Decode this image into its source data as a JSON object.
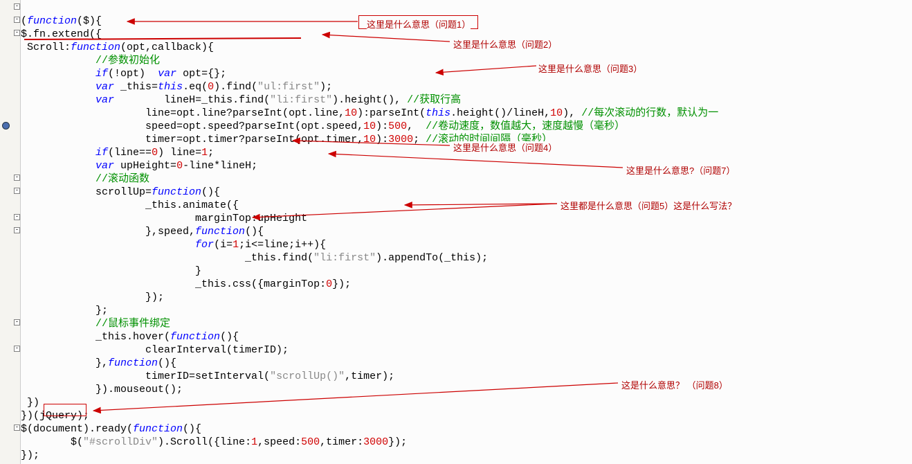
{
  "code": {
    "l1a": "(",
    "l1b": "function",
    "l1c": "($){",
    "l2a": "$.fn.extend({",
    "l3a": " Scroll:",
    "l3b": "function",
    "l3c": "(opt,callback){",
    "l4a": "            ",
    "l4cmt": "//参数初始化",
    "l5a": "            ",
    "l5b": "if",
    "l5c": "(!opt)  ",
    "l5d": "var",
    "l5e": " opt={};",
    "l6a": "            ",
    "l6b": "var",
    "l6c": " _this=",
    "l6d": "this",
    "l6e": ".eq(",
    "l6f": "0",
    "l6g": ").find(",
    "l6h": "\"ul:first\"",
    "l6i": ");",
    "l7a": "            ",
    "l7b": "var",
    "l7c": "        lineH=_this.find(",
    "l7d": "\"li:first\"",
    "l7e": ").height(), ",
    "l7cmt": "//获取行高",
    "l8a": "                    line=opt.line?parseInt(opt.line,",
    "l8b": "10",
    "l8c": "):parseInt(",
    "l8d": "this",
    "l8e": ".height()/lineH,",
    "l8f": "10",
    "l8g": "), ",
    "l8cmt": "//每次滚动的行数，默认为一",
    "l9a": "                    speed=opt.speed?parseInt(opt.speed,",
    "l9b": "10",
    "l9c": "):",
    "l9d": "500",
    "l9e": ",  ",
    "l9cmt": "//卷动速度，数值越大，速度越慢（毫秒）",
    "l10a": "                    timer=opt.timer?parseInt(opt.timer,",
    "l10b": "10",
    "l10c": "):",
    "l10d": "3000",
    "l10e": "; ",
    "l10cmt": "//滚动的时间间隔（毫秒）",
    "l11a": "            ",
    "l11b": "if",
    "l11c": "(line==",
    "l11d": "0",
    "l11e": ") line=",
    "l11f": "1",
    "l11g": ";",
    "l12a": "            ",
    "l12b": "var",
    "l12c": " upHeight=",
    "l12d": "0",
    "l12e": "-line*lineH;",
    "l13a": "            ",
    "l13cmt": "//滚动函数",
    "l14a": "            scrollUp=",
    "l14b": "function",
    "l14c": "(){",
    "l15a": "                    _this.animate({",
    "l16a": "                            marginTop:upHeight",
    "l17a": "                    },speed,",
    "l17b": "function",
    "l17c": "(){",
    "l18a": "                            ",
    "l18b": "for",
    "l18c": "(i=",
    "l18d": "1",
    "l18e": ";i<=line;i++){",
    "l19a": "                                    _this.find(",
    "l19b": "\"li:first\"",
    "l19c": ").appendTo(_this);",
    "l20a": "                            }",
    "l21a": "                            _this.css({marginTop:",
    "l21b": "0",
    "l21c": "});",
    "l22a": "                    });",
    "l23a": "            };",
    "l24a": "            ",
    "l24cmt": "//鼠标事件绑定",
    "l25a": "            _this.hover(",
    "l25b": "function",
    "l25c": "(){",
    "l26a": "                    clearInterval(timerID);",
    "l27a": "            },",
    "l27b": "function",
    "l27c": "(){",
    "l28a": "                    timerID=setInterval(",
    "l28b": "\"scrollUp()\"",
    "l28c": ",timer);",
    "l29a": "            }).mouseout();",
    "l30a": " })",
    "l31a": "})(jQuery);",
    "l32a": "$(document).ready(",
    "l32b": "function",
    "l32c": "(){",
    "l33a": "        $(",
    "l33b": "\"#scrollDiv\"",
    "l33c": ").Scroll({line:",
    "l33d": "1",
    "l33e": ",speed:",
    "l33f": "500",
    "l33g": ",timer:",
    "l33h": "3000",
    "l33i": "});",
    "l34a": "});"
  },
  "annotations": {
    "q1": "这里是什么意思（问题1）",
    "q2": "这里是什么意思（问题2）",
    "q3": "这里是什么意思（问题3）",
    "q4": "这里是什么意思（问题4）",
    "q5": "这里都是什么意思（问题5）这是什么写法？",
    "q7": "这里是什么意思?（问题7）",
    "q8": "这是什么意思？ （问题8）"
  }
}
